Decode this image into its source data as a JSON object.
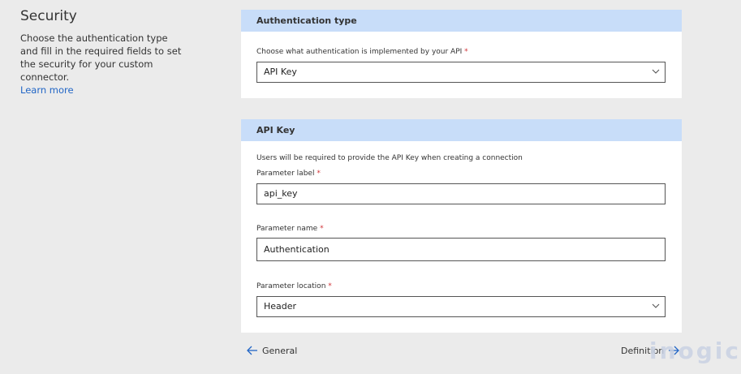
{
  "sidebar": {
    "title": "Security",
    "description": "Choose the authentication type and fill in the required fields to set the security for your custom connector.",
    "learn_more": "Learn more"
  },
  "auth_card": {
    "header": "Authentication type",
    "question_label": "Choose what authentication is implemented by your API",
    "required_mark": "*",
    "selected_value": "API Key"
  },
  "api_key_card": {
    "header": "API Key",
    "info_text": "Users will be required to provide the API Key when creating a connection",
    "param_label_label": "Parameter label",
    "param_label_value": "api_key",
    "param_name_label": "Parameter name",
    "param_name_value": "Authentication",
    "param_location_label": "Parameter location",
    "param_location_value": "Header",
    "required_mark": "*"
  },
  "nav": {
    "prev_label": "General",
    "next_label": "Definition"
  },
  "watermark": "inogic",
  "colors": {
    "accent": "#2266c6",
    "card_header_bg": "#c8ddf9",
    "required": "#d13438",
    "page_bg": "#ebebeb"
  },
  "icons": {
    "dropdown": "chevron-down-icon",
    "back": "arrow-left-icon",
    "forward": "arrow-right-icon"
  }
}
